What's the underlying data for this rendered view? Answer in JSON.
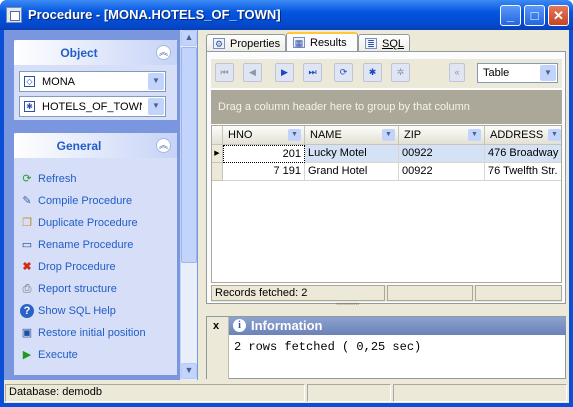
{
  "window": {
    "title": "Procedure - [MONA.HOTELS_OF_TOWN]",
    "minimize_glyph": "_",
    "maximize_glyph": "□",
    "close_glyph": "✕"
  },
  "object_panel": {
    "title": "Object",
    "database": "MONA",
    "procedure": "HOTELS_OF_TOWN"
  },
  "general_panel": {
    "title": "General",
    "actions": [
      {
        "label": "Refresh",
        "icon": "refresh-icon"
      },
      {
        "label": "Compile Procedure",
        "icon": "compile-icon"
      },
      {
        "label": "Duplicate Procedure",
        "icon": "duplicate-icon"
      },
      {
        "label": "Rename Procedure",
        "icon": "rename-icon"
      },
      {
        "label": "Drop Procedure",
        "icon": "drop-icon"
      },
      {
        "label": "Report structure",
        "icon": "report-icon"
      },
      {
        "label": "Show SQL Help",
        "icon": "help-icon"
      },
      {
        "label": "Restore initial position",
        "icon": "restore-icon"
      },
      {
        "label": "Execute",
        "icon": "execute-icon"
      }
    ]
  },
  "tabs": [
    {
      "label": "Properties",
      "active": false
    },
    {
      "label": "Results",
      "active": true
    },
    {
      "label": "SQL",
      "active": false
    }
  ],
  "toolbar": {
    "view_mode": "Table"
  },
  "grid": {
    "group_hint": "Drag a column header here to group by that column",
    "columns": [
      "HNO",
      "NAME",
      "ZIP",
      "ADDRESS"
    ],
    "rows": [
      [
        "201",
        "Lucky Motel",
        "00922",
        "476 Broadway"
      ],
      [
        "7 191",
        "Grand Hotel",
        "00922",
        "76 Twelfth Str."
      ]
    ],
    "footer": "Records fetched: 2"
  },
  "info": {
    "close_label": "x",
    "title": "Information",
    "message": "2 rows fetched ( 0,25 sec)"
  },
  "statusbar": {
    "database": "Database: demodb"
  },
  "colors": {
    "title_bar": "#0556e0",
    "left_pane": "#7a96df",
    "link_text": "#215dc6",
    "selected_row": "#d5e2f6"
  }
}
